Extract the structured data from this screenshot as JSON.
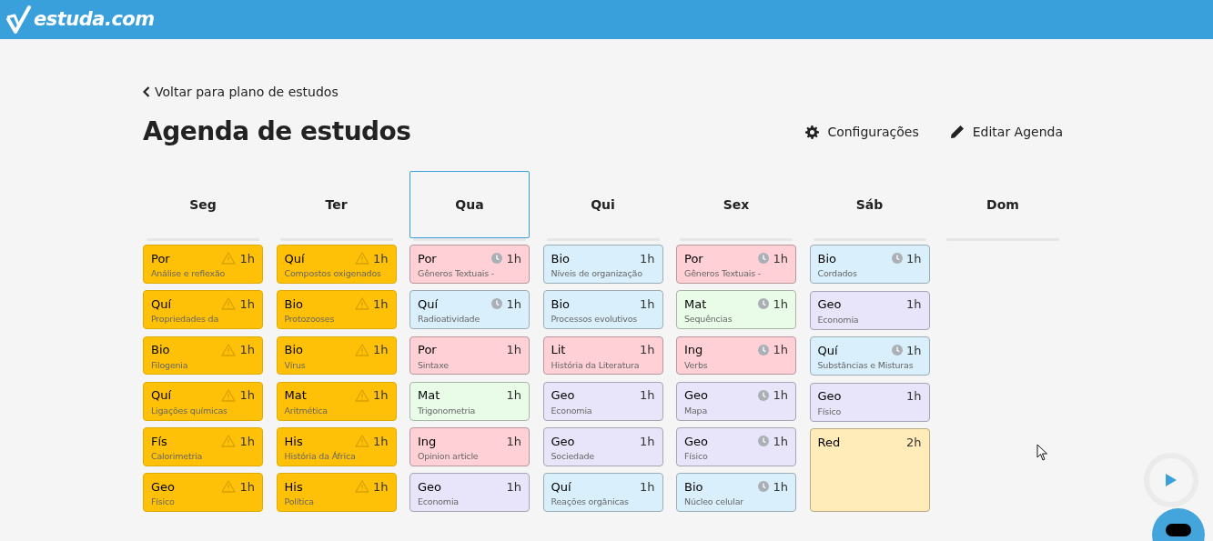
{
  "header": {
    "logo": "estuda.com"
  },
  "back_link": "Voltar para plano de estudos",
  "title": "Agenda de estudos",
  "actions": [
    {
      "kind": "settings",
      "label": "Configurações"
    },
    {
      "kind": "edit",
      "label": "Editar Agenda"
    }
  ],
  "days": [
    {
      "label": "Seg",
      "selected": false,
      "cards": [
        {
          "kind": "warning",
          "subject": "Por",
          "topic": "Análise e reflexão",
          "duration": "1h",
          "color": "#ffc107"
        },
        {
          "kind": "warning",
          "subject": "Quí",
          "topic": "Propriedades da",
          "duration": "1h",
          "color": "#ffc107"
        },
        {
          "kind": "warning",
          "subject": "Bio",
          "topic": "Filogenia",
          "duration": "1h",
          "color": "#ffc107"
        },
        {
          "kind": "warning",
          "subject": "Quí",
          "topic": "Ligações químicas",
          "duration": "1h",
          "color": "#ffc107"
        },
        {
          "kind": "warning",
          "subject": "Fís",
          "topic": "Calorimetria",
          "duration": "1h",
          "color": "#ffc107"
        },
        {
          "kind": "warning",
          "subject": "Geo",
          "topic": "Físico",
          "duration": "1h",
          "color": "#ffc107"
        }
      ]
    },
    {
      "label": "Ter",
      "selected": false,
      "cards": [
        {
          "kind": "warning",
          "subject": "Quí",
          "topic": "Compostos oxigenados",
          "duration": "1h",
          "color": "#ffc107"
        },
        {
          "kind": "warning",
          "subject": "Bio",
          "topic": "Protozooses",
          "duration": "1h",
          "color": "#ffc107"
        },
        {
          "kind": "warning",
          "subject": "Bio",
          "topic": "Vírus",
          "duration": "1h",
          "color": "#ffc107"
        },
        {
          "kind": "warning",
          "subject": "Mat",
          "topic": "Aritmética",
          "duration": "1h",
          "color": "#ffc107"
        },
        {
          "kind": "warning",
          "subject": "His",
          "topic": "História da África",
          "duration": "1h",
          "color": "#ffc107"
        },
        {
          "kind": "warning",
          "subject": "His",
          "topic": "Política",
          "duration": "1h",
          "color": "#ffc107"
        }
      ]
    },
    {
      "label": "Qua",
      "selected": true,
      "cards": [
        {
          "kind": "clock",
          "subject": "Por",
          "topic": "Gêneros Textuais -",
          "duration": "1h",
          "color": "#ffd0d6"
        },
        {
          "kind": "clock",
          "subject": "Quí",
          "topic": "Radioatividade",
          "duration": "1h",
          "color": "#d9f0fc"
        },
        {
          "kind": "plain",
          "subject": "Por",
          "topic": "Sintaxe",
          "duration": "1h",
          "color": "#ffd0d6"
        },
        {
          "kind": "plain",
          "subject": "Mat",
          "topic": "Trigonometria",
          "duration": "1h",
          "color": "#e8fce8"
        },
        {
          "kind": "plain",
          "subject": "Ing",
          "topic": "Opinion article",
          "duration": "1h",
          "color": "#ffd0d6"
        },
        {
          "kind": "plain",
          "subject": "Geo",
          "topic": "Economia",
          "duration": "1h",
          "color": "#e8e4fa"
        }
      ]
    },
    {
      "label": "Qui",
      "selected": false,
      "cards": [
        {
          "kind": "plain",
          "subject": "Bio",
          "topic": "Níveis de organização",
          "duration": "1h",
          "color": "#d9f0fc"
        },
        {
          "kind": "plain",
          "subject": "Bio",
          "topic": "Processos evolutivos",
          "duration": "1h",
          "color": "#d9f0fc"
        },
        {
          "kind": "plain",
          "subject": "Lit",
          "topic": "História da Literatura",
          "duration": "1h",
          "color": "#ffd0d6"
        },
        {
          "kind": "plain",
          "subject": "Geo",
          "topic": "Economia",
          "duration": "1h",
          "color": "#e8e4fa"
        },
        {
          "kind": "plain",
          "subject": "Geo",
          "topic": "Sociedade",
          "duration": "1h",
          "color": "#e8e4fa"
        },
        {
          "kind": "plain",
          "subject": "Quí",
          "topic": "Reações orgânicas",
          "duration": "1h",
          "color": "#d9f0fc"
        }
      ]
    },
    {
      "label": "Sex",
      "selected": false,
      "cards": [
        {
          "kind": "clock",
          "subject": "Por",
          "topic": "Gêneros Textuais -",
          "duration": "1h",
          "color": "#ffd0d6"
        },
        {
          "kind": "clock",
          "subject": "Mat",
          "topic": "Sequências",
          "duration": "1h",
          "color": "#e8fce8"
        },
        {
          "kind": "clock",
          "subject": "Ing",
          "topic": "Verbs",
          "duration": "1h",
          "color": "#ffd0d6"
        },
        {
          "kind": "clock",
          "subject": "Geo",
          "topic": "Mapa",
          "duration": "1h",
          "color": "#e8e4fa"
        },
        {
          "kind": "clock",
          "subject": "Geo",
          "topic": "Físico",
          "duration": "1h",
          "color": "#e8e4fa"
        },
        {
          "kind": "clock",
          "subject": "Bio",
          "topic": "Núcleo celular",
          "duration": "1h",
          "color": "#d9f0fc"
        }
      ]
    },
    {
      "label": "Sáb",
      "selected": false,
      "cards": [
        {
          "kind": "clock",
          "subject": "Bio",
          "topic": "Cordados",
          "duration": "1h",
          "color": "#d9f0fc"
        },
        {
          "kind": "plain",
          "subject": "Geo",
          "topic": "Economia",
          "duration": "1h",
          "color": "#e8e4fa"
        },
        {
          "kind": "clock",
          "subject": "Quí",
          "topic": "Substâncias e Misturas",
          "duration": "1h",
          "color": "#d9f0fc"
        },
        {
          "kind": "plain",
          "subject": "Geo",
          "topic": "Físico",
          "duration": "1h",
          "color": "#e8e4fa"
        },
        {
          "kind": "plain",
          "subject": "Red",
          "duration": "2h",
          "color": "#ffecb8"
        }
      ]
    },
    {
      "label": "Dom",
      "selected": false
    }
  ]
}
